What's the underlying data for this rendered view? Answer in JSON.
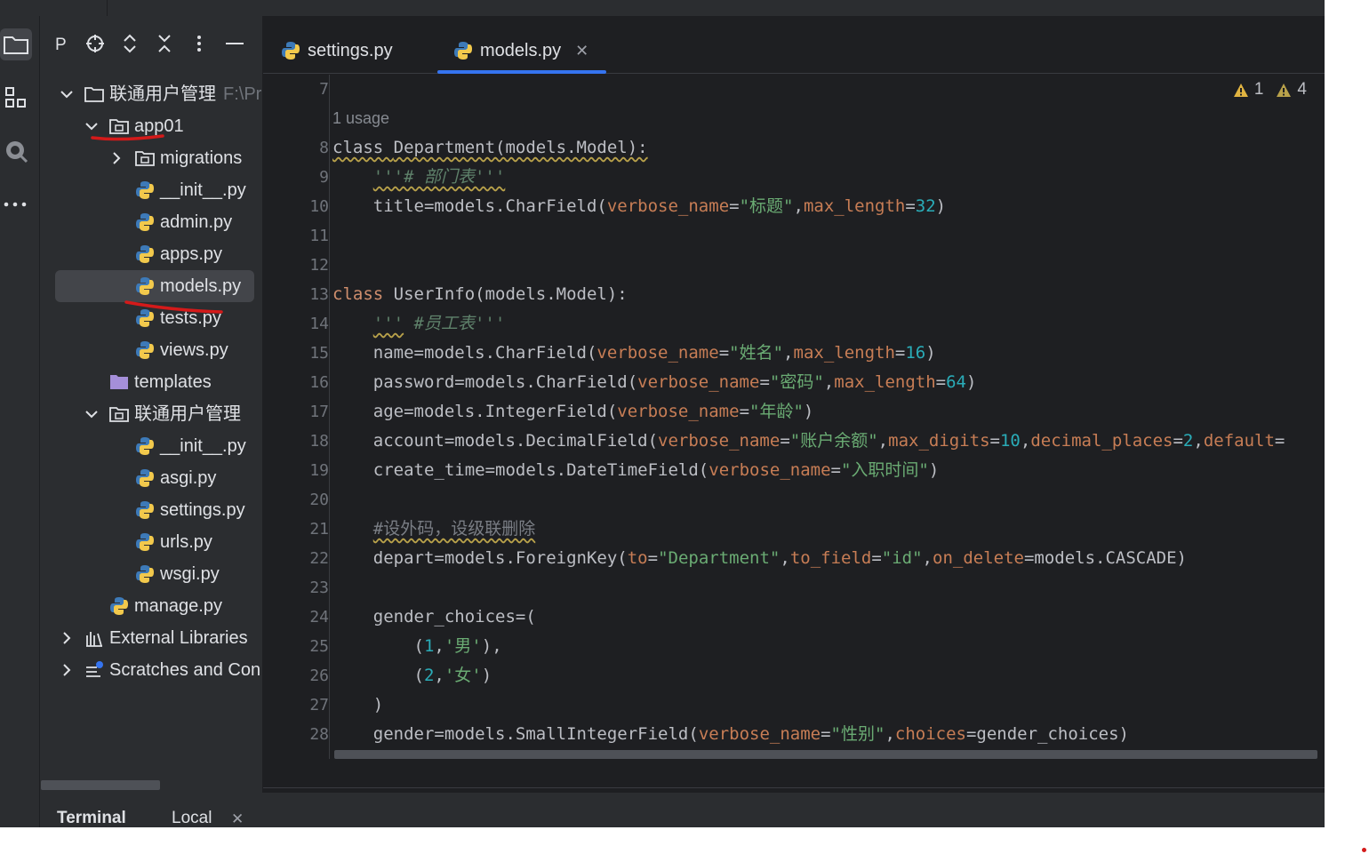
{
  "project_panel": {
    "title": "P",
    "toolbar_icons": [
      "crosshair-icon",
      "expand-collapse-icon",
      "collapse-all-icon",
      "more-vertical-icon",
      "minimize-icon"
    ],
    "tree": [
      {
        "label": "联通用户管理",
        "extra": "F:\\Pr",
        "icon": "folder",
        "level": 0,
        "chevron": "down"
      },
      {
        "label": "app01",
        "icon": "module-folder",
        "level": 1,
        "chevron": "down"
      },
      {
        "label": "migrations",
        "icon": "module-folder",
        "level": 2,
        "chevron": "right"
      },
      {
        "label": "__init__.py",
        "icon": "python",
        "level": 2
      },
      {
        "label": "admin.py",
        "icon": "python",
        "level": 2
      },
      {
        "label": "apps.py",
        "icon": "python",
        "level": 2
      },
      {
        "label": "models.py",
        "icon": "python",
        "level": 2,
        "selected": true
      },
      {
        "label": "tests.py",
        "icon": "python",
        "level": 2
      },
      {
        "label": "views.py",
        "icon": "python",
        "level": 2
      },
      {
        "label": "templates",
        "icon": "purple-folder",
        "level": 1
      },
      {
        "label": "联通用户管理",
        "icon": "module-folder",
        "level": 1,
        "chevron": "down"
      },
      {
        "label": "__init__.py",
        "icon": "python",
        "level": 2
      },
      {
        "label": "asgi.py",
        "icon": "python",
        "level": 2
      },
      {
        "label": "settings.py",
        "icon": "python",
        "level": 2
      },
      {
        "label": "urls.py",
        "icon": "python",
        "level": 2
      },
      {
        "label": "wsgi.py",
        "icon": "python",
        "level": 2
      },
      {
        "label": "manage.py",
        "icon": "python",
        "level": 1
      },
      {
        "label": "External Libraries",
        "icon": "libraries",
        "level": 0,
        "chevron": "right"
      },
      {
        "label": "Scratches and Con",
        "icon": "scratches",
        "level": 0,
        "chevron": "right"
      }
    ]
  },
  "editor": {
    "tabs": [
      {
        "label": "settings.py",
        "active": false
      },
      {
        "label": "models.py",
        "active": true
      }
    ],
    "inspections": {
      "warning_count_a": "1",
      "warning_count_b": "4"
    },
    "usage_hint": "1 usage",
    "line_numbers": [
      "7",
      "8",
      "9",
      "10",
      "11",
      "12",
      "13",
      "14",
      "15",
      "16",
      "17",
      "18",
      "19",
      "20",
      "21",
      "22",
      "23",
      "24",
      "25",
      "26",
      "27",
      "28"
    ]
  },
  "terminal": {
    "title": "Terminal",
    "tab": "Local"
  },
  "colors": {
    "accent": "#3574f0",
    "background": "#1e1f22",
    "panel": "#2b2d30",
    "annotation": "#d41a1a"
  }
}
